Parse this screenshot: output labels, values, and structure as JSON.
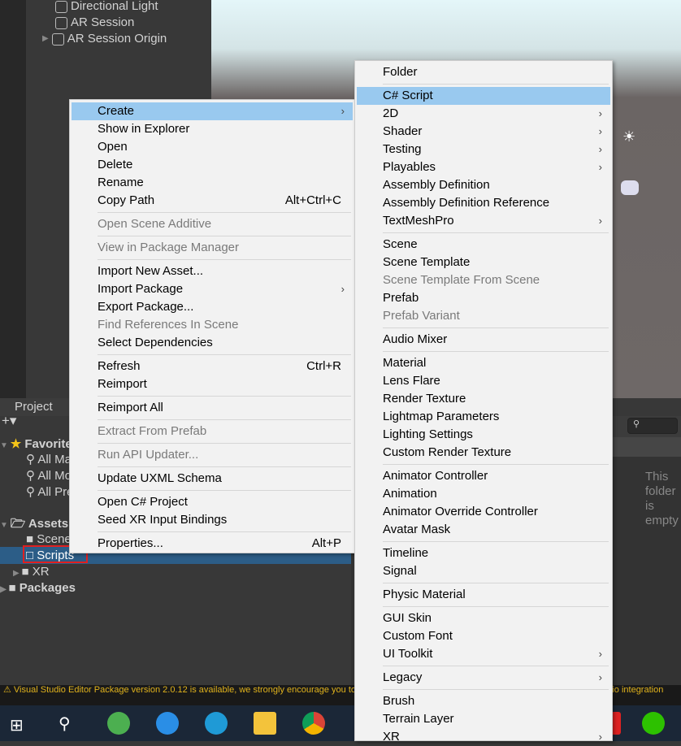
{
  "hierarchy": {
    "items": [
      {
        "label": "Directional Light",
        "expand": false
      },
      {
        "label": "AR Session",
        "expand": false
      },
      {
        "label": "AR Session Origin",
        "expand": true
      }
    ]
  },
  "project": {
    "tab": "Project",
    "add": "+▾",
    "favorites": "Favorites",
    "fav_items": [
      "All Materials",
      "All Models",
      "All Prefabs"
    ],
    "assets": "Assets",
    "asset_items": [
      "Scenes",
      "Scripts",
      "XR"
    ],
    "packages": "Packages",
    "selected": "Scripts",
    "search_icon": "search-icon",
    "empty_text": "This folder is empty"
  },
  "status": {
    "icon": "warning-icon",
    "text": "Visual Studio Editor Package version 2.0.12 is available, we strongly encourage you to update from the Unity Package Manager for a better Visual Studio integration",
    "color": "#e0b21c"
  },
  "taskbar": {
    "icons": [
      "windows-start-icon",
      "search-icon",
      "360-browser-icon",
      "internet-explorer-icon",
      "edge-icon",
      "file-explorer-icon",
      "chrome-icon",
      "app-icon",
      "app-red-icon",
      "wechat-icon"
    ]
  },
  "context_menu": {
    "items": [
      {
        "label": "Create",
        "submenu": true,
        "highlight": true
      },
      {
        "label": "Show in Explorer"
      },
      {
        "label": "Open"
      },
      {
        "label": "Delete"
      },
      {
        "label": "Rename"
      },
      {
        "label": "Copy Path",
        "shortcut": "Alt+Ctrl+C"
      },
      {
        "sep": true
      },
      {
        "label": "Open Scene Additive",
        "disabled": true
      },
      {
        "sep": true
      },
      {
        "label": "View in Package Manager",
        "disabled": true
      },
      {
        "sep": true
      },
      {
        "label": "Import New Asset..."
      },
      {
        "label": "Import Package",
        "submenu": true
      },
      {
        "label": "Export Package..."
      },
      {
        "label": "Find References In Scene",
        "disabled": true
      },
      {
        "label": "Select Dependencies"
      },
      {
        "sep": true
      },
      {
        "label": "Refresh",
        "shortcut": "Ctrl+R"
      },
      {
        "label": "Reimport"
      },
      {
        "sep": true
      },
      {
        "label": "Reimport All"
      },
      {
        "sep": true
      },
      {
        "label": "Extract From Prefab",
        "disabled": true
      },
      {
        "sep": true
      },
      {
        "label": "Run API Updater...",
        "disabled": true
      },
      {
        "sep": true
      },
      {
        "label": "Update UXML Schema"
      },
      {
        "sep": true
      },
      {
        "label": "Open C# Project"
      },
      {
        "label": "Seed XR Input Bindings"
      },
      {
        "sep": true
      },
      {
        "label": "Properties...",
        "shortcut": "Alt+P"
      }
    ]
  },
  "create_menu": {
    "items": [
      {
        "label": "Folder"
      },
      {
        "sep": true
      },
      {
        "label": "C# Script",
        "highlight": true
      },
      {
        "label": "2D",
        "submenu": true
      },
      {
        "label": "Shader",
        "submenu": true
      },
      {
        "label": "Testing",
        "submenu": true
      },
      {
        "label": "Playables",
        "submenu": true
      },
      {
        "label": "Assembly Definition"
      },
      {
        "label": "Assembly Definition Reference"
      },
      {
        "label": "TextMeshPro",
        "submenu": true
      },
      {
        "sep": true
      },
      {
        "label": "Scene"
      },
      {
        "label": "Scene Template"
      },
      {
        "label": "Scene Template From Scene",
        "disabled": true
      },
      {
        "label": "Prefab"
      },
      {
        "label": "Prefab Variant",
        "disabled": true
      },
      {
        "sep": true
      },
      {
        "label": "Audio Mixer"
      },
      {
        "sep": true
      },
      {
        "label": "Material"
      },
      {
        "label": "Lens Flare"
      },
      {
        "label": "Render Texture"
      },
      {
        "label": "Lightmap Parameters"
      },
      {
        "label": "Lighting Settings"
      },
      {
        "label": "Custom Render Texture"
      },
      {
        "sep": true
      },
      {
        "label": "Animator Controller"
      },
      {
        "label": "Animation"
      },
      {
        "label": "Animator Override Controller"
      },
      {
        "label": "Avatar Mask"
      },
      {
        "sep": true
      },
      {
        "label": "Timeline"
      },
      {
        "label": "Signal"
      },
      {
        "sep": true
      },
      {
        "label": "Physic Material"
      },
      {
        "sep": true
      },
      {
        "label": "GUI Skin"
      },
      {
        "label": "Custom Font"
      },
      {
        "label": "UI Toolkit",
        "submenu": true
      },
      {
        "sep": true
      },
      {
        "label": "Legacy",
        "submenu": true
      },
      {
        "sep": true
      },
      {
        "label": "Brush"
      },
      {
        "label": "Terrain Layer"
      },
      {
        "label": "XR",
        "submenu": true
      }
    ]
  }
}
